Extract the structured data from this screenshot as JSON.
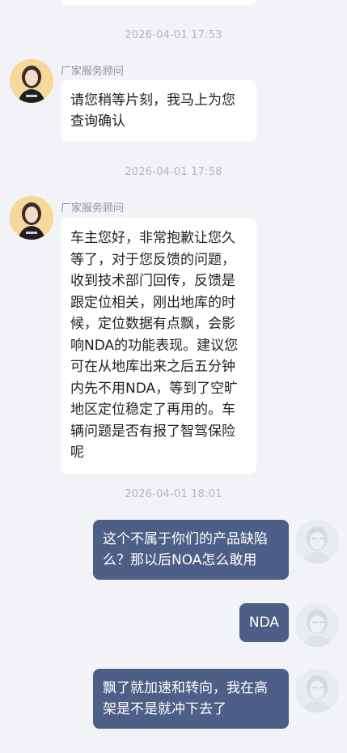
{
  "timestamps": [
    "2026-04-01 17:53",
    "2026-04-01 17:58",
    "2026-04-01 18:01"
  ],
  "agent": {
    "name": "厂家服务顾问"
  },
  "messages": {
    "m1": "请您稍等片刻，我马上为您查询确认",
    "m2": "车主您好，非常抱歉让您久等了，对于您反馈的问题，收到技术部门回传，反馈是跟定位相关，刚出地库的时候，定位数据有点飘，会影响NDA的功能表现。建议您可在从地库出来之后五分钟内先不用NDA，等到了空旷地区定位稳定了再用的。车辆问题是否有报了智驾保险呢",
    "m3": "这个不属于你们的产品缺陷么？那以后NOA怎么敢用",
    "m4": "NDA",
    "m5": "飘了就加速和转向，我在高架是不是就冲下去了"
  },
  "colors": {
    "background": "#f2f3f7",
    "incoming_bubble": "#ffffff",
    "outgoing_bubble": "#4d5f86",
    "timestamp_text": "#b3b6bd"
  },
  "icons": {
    "agent_avatar": "agent-avatar-icon",
    "user_avatar": "user-avatar-icon"
  }
}
